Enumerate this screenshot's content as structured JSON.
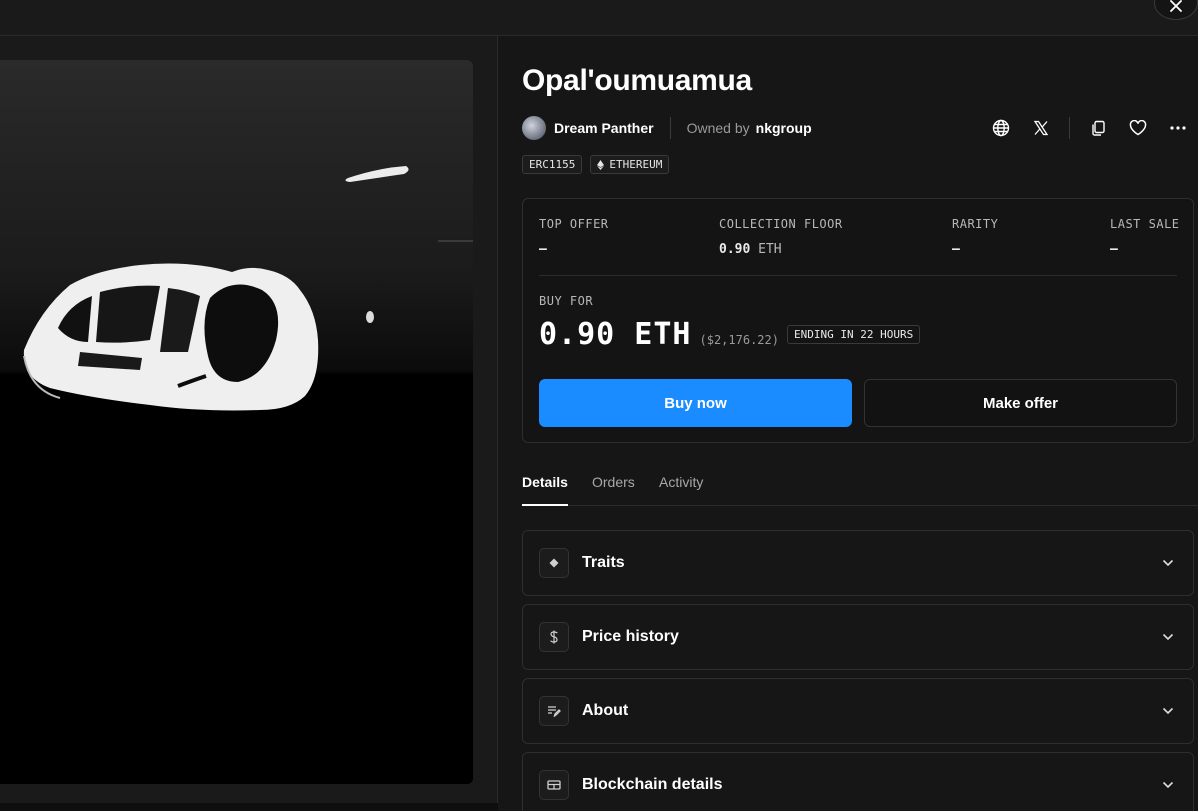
{
  "item": {
    "title": "Opal'oumuamua",
    "creator": "Dream Panther",
    "owned_by_label": "Owned by",
    "owner": "nkgroup",
    "badges": [
      "ERC1155",
      "ETHEREUM"
    ]
  },
  "stats": [
    {
      "label": "TOP OFFER",
      "value": "–",
      "unit": ""
    },
    {
      "label": "COLLECTION FLOOR",
      "value": "0.90",
      "unit": "ETH"
    },
    {
      "label": "RARITY",
      "value": "–",
      "unit": ""
    },
    {
      "label": "LAST SALE",
      "value": "–",
      "unit": ""
    }
  ],
  "buy": {
    "label": "BUY FOR",
    "price": "0.90 ETH",
    "usd": "($2,176.22)",
    "ending": "ENDING IN 22 HOURS",
    "buy_now": "Buy now",
    "make_offer": "Make offer"
  },
  "tabs": [
    "Details",
    "Orders",
    "Activity"
  ],
  "sections": [
    {
      "title": "Traits",
      "icon": "diamond-icon"
    },
    {
      "title": "Price history",
      "icon": "dollar-icon"
    },
    {
      "title": "About",
      "icon": "edit-icon"
    },
    {
      "title": "Blockchain details",
      "icon": "blocks-icon"
    }
  ],
  "colors": {
    "background": "#161616",
    "accent": "#1a8cff",
    "border": "#2e2e2e"
  },
  "icons": [
    "close-icon",
    "globe-icon",
    "x-logo-icon",
    "copy-icon",
    "heart-icon",
    "more-icon",
    "ethereum-icon",
    "chevron-down-icon"
  ]
}
